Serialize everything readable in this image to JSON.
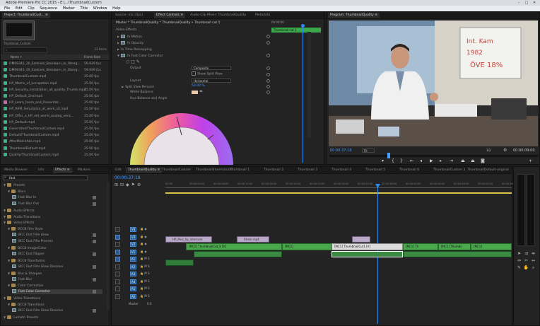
{
  "app": {
    "title": "Adobe Premiere Pro CC 2015 - E:\\...\\ThumbnailCustom",
    "menus": [
      "File",
      "Edit",
      "Clip",
      "Sequence",
      "Marker",
      "Title",
      "Window",
      "Help"
    ]
  },
  "project": {
    "tab": "Project: ThumbnailCust... ≡",
    "bin_name": "Thumbnail_Custom",
    "items_count": "23 Items",
    "col_name": "Name ↑",
    "col_rate": "Frame Rate",
    "items": [
      {
        "name": "DM09345_20_Ezekiels_Steinborn_in_Oberg...",
        "rate": "59.939 fps",
        "color": "#3bb28a"
      },
      {
        "name": "DM09345_20_Ezekiels_Steinborn_in_Oberg...",
        "rate": "59.939 fps",
        "color": "#3bb28a"
      },
      {
        "name": "ThumbnailCustom.mp4",
        "rate": "25.00 fps",
        "color": "#3bb28a"
      },
      {
        "name": "HP_Matrix_of_occupation.mp4",
        "rate": "25.00 fps",
        "color": "#3bb28a"
      },
      {
        "name": "HP_Security_Installation_all_quality_Thumb.mp4",
        "rate": "25.00 fps",
        "color": "#3bb28a"
      },
      {
        "name": "HP_Default_2nd.mp4",
        "rate": "25.00 fps",
        "color": "#3bb28a"
      },
      {
        "name": "HP_Learn_team_and_Presentat...",
        "rate": "25.00 fps",
        "color": "#c26fa5"
      },
      {
        "name": "HP_RAM_Simulation_at_work_sit.mp4",
        "rate": "25.00 fps",
        "color": "#3bb28a"
      },
      {
        "name": "HP_Offer_a_HP_old_world_analog_versi...",
        "rate": "25.00 fps",
        "color": "#3bb28a"
      },
      {
        "name": "HP_Default.mp4",
        "rate": "25.00 fps",
        "color": "#3bb28a"
      },
      {
        "name": "Generated/ThumbnailCustom.mp4",
        "rate": "25.00 fps",
        "color": "#3bb28a"
      },
      {
        "name": "Default/ThumbnailCustom.mp4",
        "rate": "25.00 fps",
        "color": "#3bb28a"
      },
      {
        "name": "AfterMatchAds.mp4",
        "rate": "25.00 fps",
        "color": "#3bb28a"
      },
      {
        "name": "ThumbnailDefault.mp4",
        "rate": "25.00 fps",
        "color": "#3bb28a"
      },
      {
        "name": "Quality/ThumbnailCustom.mp4",
        "rate": "25.00 fps",
        "color": "#3bb28a"
      }
    ]
  },
  "source_tabs": [
    "Source: (no clips)",
    "Effect Controls ≡",
    "Audio Clip Mixer: ThumbnailQuality",
    "Metadata"
  ],
  "effect_controls": {
    "master": "Master * ThumbnailQuality * ThumbnailQuality • Thumbnail cut 1",
    "section": "Video Effects",
    "rows": [
      "fx Motion",
      "fx Opacity",
      "fx Time Remapping",
      "fx Fast Color Corrector"
    ],
    "output_label": "Output",
    "output_value": "Composite",
    "show_split": "Show Split View",
    "layout_label": "Layout",
    "layout_value": "Horizontal",
    "split_label": "Split View Percent",
    "split_value": "50.00 %",
    "white_balance": "White Balance",
    "hue_balance": "Hue Balance and Angle",
    "timecode": "00:00:00",
    "clip_label": "Thumbnail cut 1"
  },
  "program": {
    "tab": "Program: ThumbnailQuality ≡",
    "timecode": "00:00:37:19",
    "fit": "Fit",
    "quality": "1/2",
    "duration": "00:00:09:00",
    "whiteboard_text": "Int. Kam 1982 ÖVE RA 18%"
  },
  "effects_panel": {
    "tabs": [
      "Media Browser",
      "Info",
      "Effects ≡",
      "Markers"
    ],
    "search": "fast",
    "tree": [
      {
        "label": "Presets",
        "type": "bin",
        "depth": 0
      },
      {
        "label": "Blurs",
        "type": "bin",
        "depth": 1
      },
      {
        "label": "Fast Blur In",
        "type": "fx",
        "depth": 2
      },
      {
        "label": "Fast Blur Out",
        "type": "fx",
        "depth": 2
      },
      {
        "label": "Audio Effects",
        "type": "bin",
        "depth": 0
      },
      {
        "label": "Audio Transitions",
        "type": "bin",
        "depth": 0
      },
      {
        "label": "Video Effects",
        "type": "bin",
        "depth": 0
      },
      {
        "label": "BCC8 Film Style",
        "type": "bin",
        "depth": 1
      },
      {
        "label": "BCC Fast Film Glow",
        "type": "fx",
        "depth": 2
      },
      {
        "label": "BCC Fast Film Process",
        "type": "fx",
        "depth": 2
      },
      {
        "label": "BCC8 Image/Color",
        "type": "bin",
        "depth": 1
      },
      {
        "label": "BCC Fast Flipper",
        "type": "fx",
        "depth": 2
      },
      {
        "label": "BCC8 Transforms",
        "type": "bin",
        "depth": 1
      },
      {
        "label": "BCC Fast Film Glow Dissolve",
        "type": "fx",
        "depth": 2
      },
      {
        "label": "Blur & Sharpen",
        "type": "bin",
        "depth": 1
      },
      {
        "label": "Fast Blur",
        "type": "fx",
        "depth": 2
      },
      {
        "label": "Color Correction",
        "type": "bin",
        "depth": 1
      },
      {
        "label": "Fast Color Corrector",
        "type": "fx",
        "depth": 2,
        "selected": true
      },
      {
        "label": "Video Transitions",
        "type": "bin",
        "depth": 0
      },
      {
        "label": "BCC8 Transitions",
        "type": "bin",
        "depth": 1
      },
      {
        "label": "BCC Fast Film Glow Dissolve",
        "type": "fx",
        "depth": 2
      },
      {
        "label": "Lumetri Presets",
        "type": "bin",
        "depth": 0
      }
    ]
  },
  "timeline": {
    "tabs": [
      "Edit",
      "ThumbnailQuality ≡",
      "ThumbnailCustom",
      "ThumbnailIntermission",
      "Thumbnail 1",
      "Thumbnail 2",
      "Thumbnail 3",
      "Thumbnail 4",
      "Thumbnail 5",
      "Thumbnail 6",
      "ThumbnailCustom 2",
      "ThumbnailDefault-original"
    ],
    "timecode": "00:00:37:19",
    "ruler": [
      "00:00",
      "00:00:04:00",
      "00:00:08:00",
      "00:00:12:00",
      "00:00:16:00",
      "00:00:20:00",
      "00:00:24:00",
      "00:00:28:00",
      "00:00:32:00",
      "00:00:36:00",
      "00:00:40:00",
      "00:00:44:00",
      "00:00:48:00",
      "00:00:52:00",
      "00:00:56:00"
    ],
    "video_tracks": [
      "V4",
      "V3",
      "V2",
      "V1"
    ],
    "audio_tracks": [
      "A1",
      "A2",
      "A3",
      "A4",
      "A5",
      "A6"
    ],
    "master": "Master",
    "master_value": "0.0",
    "clips": {
      "v3a": "HP_Plus_hp_intercom",
      "v3b": "Rhein.mp4",
      "v2a": "[MC1] ThumbnailCut_V [V]",
      "v2b": "[MC1] ThumbnailCut1 [V]",
      "v2small": "[MC1]",
      "v2c": "[MC1] Th",
      "v2d": "[MC1] Thumbn"
    }
  },
  "colors": {
    "accent": "#2d8cf0",
    "clip_green": "#49a84b",
    "clip_audio": "#2f7c3a",
    "clip_purple": "#b8a7c7"
  }
}
